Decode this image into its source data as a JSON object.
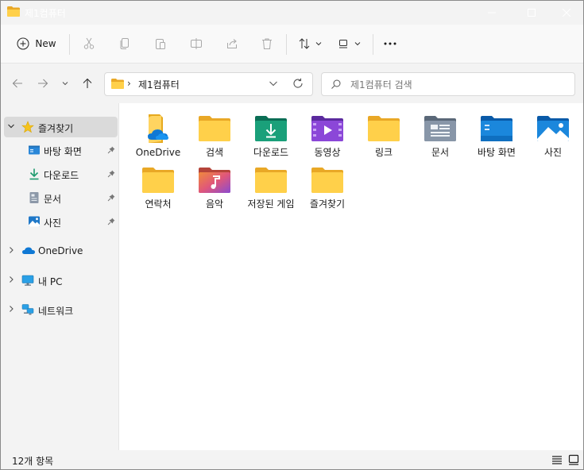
{
  "window": {
    "title": "제1컴퓨터"
  },
  "toolbar": {
    "new_label": "New"
  },
  "address": {
    "path": "제1컴퓨터"
  },
  "search": {
    "placeholder": "제1컴퓨터 검색"
  },
  "sidebar": {
    "items": [
      {
        "label": "즐겨찾기",
        "icon": "star-icon"
      },
      {
        "label": "바탕 화면",
        "icon": "desktop-icon"
      },
      {
        "label": "다운로드",
        "icon": "download-icon"
      },
      {
        "label": "문서",
        "icon": "document-icon"
      },
      {
        "label": "사진",
        "icon": "pictures-icon"
      },
      {
        "label": "OneDrive",
        "icon": "onedrive-icon"
      },
      {
        "label": "내 PC",
        "icon": "pc-icon"
      },
      {
        "label": "네트워크",
        "icon": "network-icon"
      }
    ]
  },
  "content": {
    "items": [
      {
        "label": "OneDrive",
        "icon": "onedrive-folder-icon"
      },
      {
        "label": "검색",
        "icon": "folder-icon"
      },
      {
        "label": "다운로드",
        "icon": "downloads-folder-icon"
      },
      {
        "label": "동영상",
        "icon": "videos-folder-icon"
      },
      {
        "label": "링크",
        "icon": "folder-icon"
      },
      {
        "label": "문서",
        "icon": "documents-folder-icon"
      },
      {
        "label": "바탕 화면",
        "icon": "desktop-folder-icon"
      },
      {
        "label": "사진",
        "icon": "pictures-folder-icon"
      },
      {
        "label": "연락처",
        "icon": "folder-icon"
      },
      {
        "label": "음악",
        "icon": "music-folder-icon"
      },
      {
        "label": "저장된 게임",
        "icon": "folder-icon"
      },
      {
        "label": "즐겨찾기",
        "icon": "folder-icon"
      }
    ]
  },
  "status": {
    "item_count": "12개 항목"
  },
  "colors": {
    "folder": "#f5c543",
    "accent": "#0067c0",
    "selected": "#dadada"
  }
}
